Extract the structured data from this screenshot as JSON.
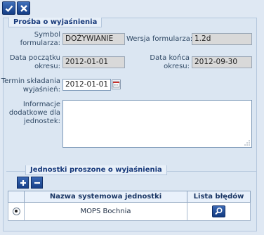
{
  "form": {
    "section_title": "Prośba o wyjaśnienia",
    "symbol_label": "Symbol\nformularza:",
    "symbol_value": "DOŻYWIANIE",
    "version_label": "Wersja formularza:",
    "version_value": "1.2d",
    "period_start_label": "Data początku\nokresu:",
    "period_start_value": "2012-01-01",
    "period_end_label": "Data końca\nokresu:",
    "period_end_value": "2012-09-30",
    "deadline_label": "Termin składania\nwyjaśnień:",
    "deadline_value": "2012-01-01",
    "info_label": "Informacje\ndodatkowe dla\njednostek:",
    "info_value": ""
  },
  "units": {
    "section_title": "Jednostki proszone o wyjaśnienia",
    "columns": [
      "",
      "Nazwa systemowa jednostki",
      "Lista błędów"
    ],
    "rows": [
      {
        "name": "MOPS Bochnia",
        "selected": true
      }
    ]
  },
  "colors": {
    "accent": "#1a4589",
    "background": "#dfe8f3"
  }
}
